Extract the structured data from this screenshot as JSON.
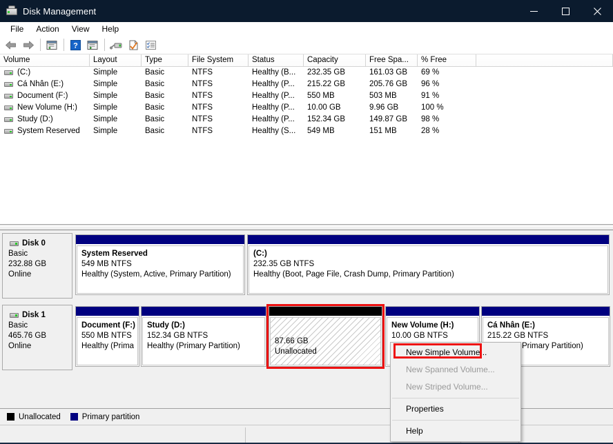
{
  "window": {
    "title": "Disk Management",
    "icon": "disk-management-icon",
    "controls": {
      "minimize": "minimize-icon",
      "maximize": "maximize-icon",
      "close": "close-icon"
    }
  },
  "menubar": {
    "items": [
      "File",
      "Action",
      "View",
      "Help"
    ]
  },
  "toolbar": {
    "buttons": [
      "back-arrow-icon",
      "forward-arrow-icon",
      "separator",
      "up-one-level-icon",
      "separator",
      "help-icon",
      "show-console-tree-icon",
      "separator",
      "rescan-disks-icon",
      "properties-check-icon",
      "detail-list-icon"
    ]
  },
  "volume_list": {
    "columns": [
      "Volume",
      "Layout",
      "Type",
      "File System",
      "Status",
      "Capacity",
      "Free Spa...",
      "% Free"
    ],
    "rows": [
      {
        "volume": "(C:)",
        "layout": "Simple",
        "type": "Basic",
        "filesystem": "NTFS",
        "status": "Healthy (B...",
        "capacity": "232.35 GB",
        "free": "161.03 GB",
        "pctfree": "69 %"
      },
      {
        "volume": "Cá Nhân (E:)",
        "layout": "Simple",
        "type": "Basic",
        "filesystem": "NTFS",
        "status": "Healthy (P...",
        "capacity": "215.22 GB",
        "free": "205.76 GB",
        "pctfree": "96 %"
      },
      {
        "volume": "Document (F:)",
        "layout": "Simple",
        "type": "Basic",
        "filesystem": "NTFS",
        "status": "Healthy (P...",
        "capacity": "550 MB",
        "free": "503 MB",
        "pctfree": "91 %"
      },
      {
        "volume": "New Volume (H:)",
        "layout": "Simple",
        "type": "Basic",
        "filesystem": "NTFS",
        "status": "Healthy (P...",
        "capacity": "10.00 GB",
        "free": "9.96 GB",
        "pctfree": "100 %"
      },
      {
        "volume": "Study (D:)",
        "layout": "Simple",
        "type": "Basic",
        "filesystem": "NTFS",
        "status": "Healthy (P...",
        "capacity": "152.34 GB",
        "free": "149.87 GB",
        "pctfree": "98 %"
      },
      {
        "volume": "System Reserved",
        "layout": "Simple",
        "type": "Basic",
        "filesystem": "NTFS",
        "status": "Healthy (S...",
        "capacity": "549 MB",
        "free": "151 MB",
        "pctfree": "28 %"
      }
    ]
  },
  "disks": [
    {
      "name": "Disk 0",
      "type": "Basic",
      "size": "232.88 GB",
      "state": "Online",
      "partitions": [
        {
          "name": "System Reserved",
          "size_fs": "549 MB NTFS",
          "health": "Healthy (System, Active, Primary Partition)",
          "kind": "primary",
          "selected": false
        },
        {
          "name": "(C:)",
          "size_fs": "232.35 GB NTFS",
          "health": "Healthy (Boot, Page File, Crash Dump, Primary Partition)",
          "kind": "primary",
          "selected": false
        }
      ]
    },
    {
      "name": "Disk 1",
      "type": "Basic",
      "size": "465.76 GB",
      "state": "Online",
      "partitions": [
        {
          "name": "Document  (F:)",
          "size_fs": "550 MB NTFS",
          "health": "Healthy (Prima",
          "kind": "primary",
          "selected": false
        },
        {
          "name": "Study  (D:)",
          "size_fs": "152.34 GB NTFS",
          "health": "Healthy (Primary Partition)",
          "kind": "primary",
          "selected": false
        },
        {
          "name": "",
          "size_fs": "87.66 GB",
          "health": "Unallocated",
          "kind": "unallocated",
          "selected": true
        },
        {
          "name": "New Volume  (H:)",
          "size_fs": "10.00 GB NTFS",
          "health": "",
          "kind": "primary",
          "selected": false
        },
        {
          "name": "Cá Nhân  (E:)",
          "size_fs": "215.22 GB NTFS",
          "health": "Primary Partition)",
          "kind": "primary",
          "selected": false
        }
      ]
    }
  ],
  "legend": [
    {
      "label": "Unallocated",
      "color": "#000000"
    },
    {
      "label": "Primary partition",
      "color": "#000080"
    }
  ],
  "context_menu": {
    "items": [
      {
        "label": "New Simple Volume...",
        "enabled": true,
        "highlighted": true
      },
      {
        "label": "New Spanned Volume...",
        "enabled": false,
        "highlighted": false
      },
      {
        "label": "New Striped Volume...",
        "enabled": false,
        "highlighted": false
      },
      {
        "label": "---",
        "enabled": false,
        "highlighted": false
      },
      {
        "label": "Properties",
        "enabled": true,
        "highlighted": false
      },
      {
        "label": "---",
        "enabled": false,
        "highlighted": false
      },
      {
        "label": "Help",
        "enabled": true,
        "highlighted": false
      }
    ]
  },
  "colors": {
    "titlebar": "#0b1b2e",
    "primary_partition": "#000080",
    "unallocated": "#000000",
    "selection_red": "#ee1111"
  }
}
